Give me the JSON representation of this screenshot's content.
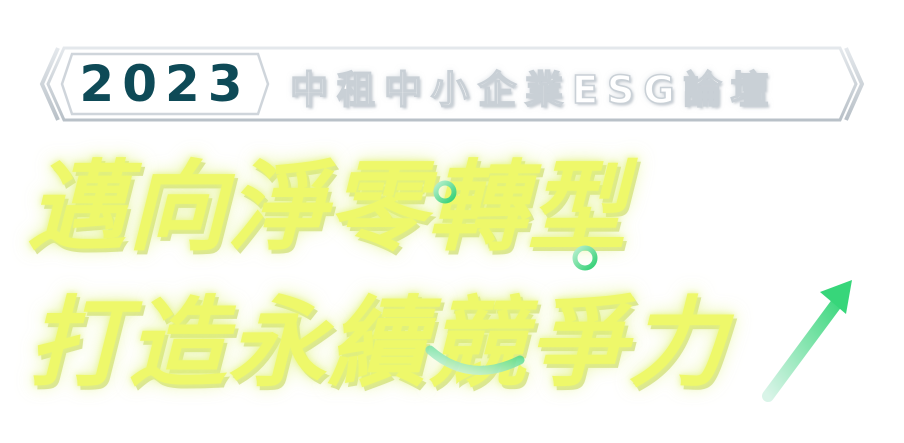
{
  "badge": {
    "year": "2023",
    "title": "中租中小企業ESG論壇"
  },
  "headline": {
    "line1": "邁向淨零轉型",
    "line2": "打造永續競爭力"
  },
  "colors": {
    "year_text": "#0e4a57",
    "headline_fill": "#eef86a",
    "accent_green": "#4be08a",
    "frame_stroke": "#c9d0d6"
  },
  "icons": {
    "arrow": "up-right-arrow-icon",
    "circle": "ring-icon"
  }
}
